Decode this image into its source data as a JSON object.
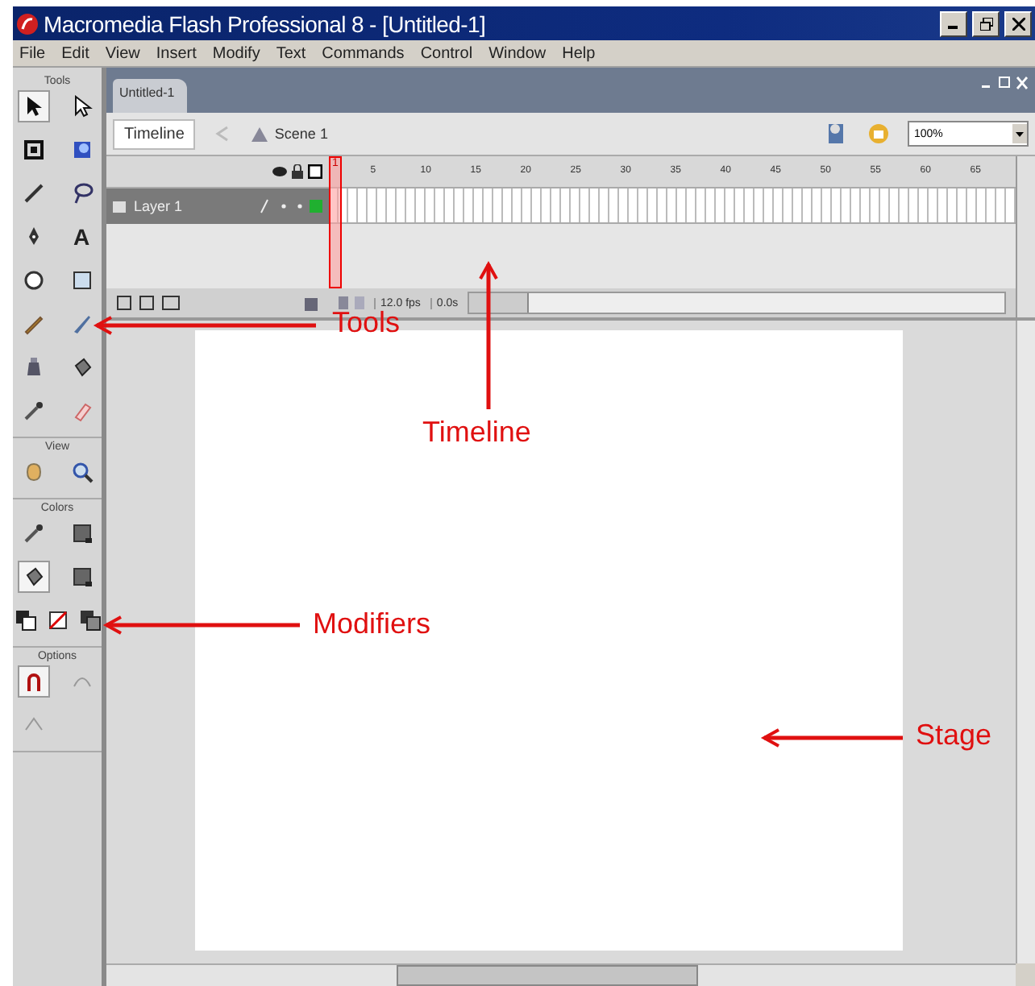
{
  "window": {
    "title": "Macromedia Flash Professional 8 - [Untitled-1]"
  },
  "menu": [
    "File",
    "Edit",
    "View",
    "Insert",
    "Modify",
    "Text",
    "Commands",
    "Control",
    "Window",
    "Help"
  ],
  "tools_panel": {
    "sections": [
      {
        "label": "Tools",
        "tools": [
          {
            "kind": "arrow",
            "selected": true
          },
          {
            "kind": "subselect",
            "selected": false
          },
          {
            "kind": "transform",
            "selected": false
          },
          {
            "kind": "gradient",
            "selected": false
          },
          {
            "kind": "line",
            "selected": false
          },
          {
            "kind": "lasso",
            "selected": false
          },
          {
            "kind": "pen",
            "selected": false
          },
          {
            "kind": "text",
            "label": "A",
            "selected": false
          },
          {
            "kind": "oval",
            "selected": false
          },
          {
            "kind": "rect",
            "selected": false
          },
          {
            "kind": "pencil",
            "selected": false
          },
          {
            "kind": "brush",
            "selected": false
          },
          {
            "kind": "inkbottle",
            "selected": false
          },
          {
            "kind": "bucket",
            "selected": false
          },
          {
            "kind": "eyedropper",
            "selected": false
          },
          {
            "kind": "eraser",
            "selected": false
          }
        ]
      },
      {
        "label": "View",
        "tools": [
          {
            "kind": "hand",
            "selected": false
          },
          {
            "kind": "zoom",
            "selected": false
          }
        ]
      },
      {
        "label": "Colors",
        "tools": [
          {
            "kind": "stroke",
            "selected": false
          },
          {
            "kind": "swatch",
            "selected": false
          },
          {
            "kind": "fillbucket",
            "selected": true
          },
          {
            "kind": "swatch",
            "selected": false
          },
          {
            "kind": "bw",
            "selected": false
          },
          {
            "kind": "nocolor",
            "selected": false
          },
          {
            "kind": "swap",
            "selected": false
          }
        ]
      },
      {
        "label": "Options",
        "tools": [
          {
            "kind": "magnet",
            "selected": true
          },
          {
            "kind": "smooth",
            "selected": false
          },
          {
            "kind": "straighten",
            "selected": false
          }
        ]
      }
    ]
  },
  "document": {
    "tab": "Untitled-1",
    "timeline_button": "Timeline",
    "scene": "Scene 1",
    "zoom": "100%",
    "frame_numbers": [
      "1",
      "5",
      "10",
      "15",
      "20",
      "25",
      "30",
      "35",
      "40",
      "45",
      "50",
      "55",
      "60",
      "65"
    ],
    "layers": [
      {
        "name": "Layer 1",
        "selected": true
      }
    ],
    "fps": "12.0 fps",
    "time": "0.0s"
  },
  "annotations": [
    {
      "label": "Tools"
    },
    {
      "label": "Timeline"
    },
    {
      "label": "Modifiers"
    },
    {
      "label": "Stage"
    }
  ]
}
